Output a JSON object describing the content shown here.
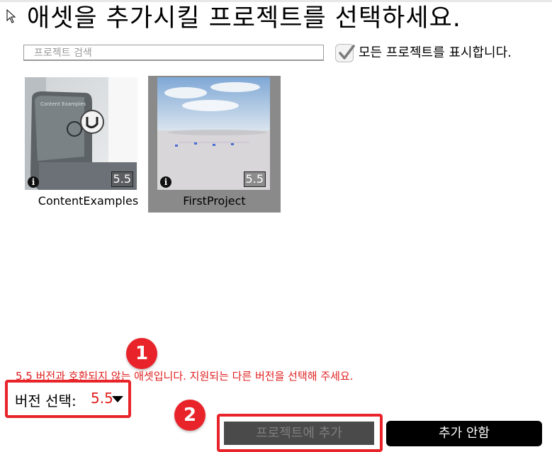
{
  "dialog": {
    "title": "애셋을 추가시킬 프로젝트를 선택하세요.",
    "search_placeholder": "프로젝트 검색",
    "show_all_label": "모든 프로젝트를 표시합니다.",
    "show_all_checked": true
  },
  "projects": [
    {
      "name": "ContentExamples",
      "version": "5.5",
      "selected": false,
      "thumb_text": "Content Examples"
    },
    {
      "name": "FirstProject",
      "version": "5.5",
      "selected": true
    }
  ],
  "footer": {
    "warning": "5.5 버전과 호환되지 않는 애셋입니다. 지원되는 다른 버전을 선택해 주세요.",
    "version_label": "버전 선택:",
    "version_value": "5.5",
    "add_button": "프로젝트에 추가",
    "cancel_button": "추가 안함"
  },
  "annotations": [
    "1",
    "2"
  ],
  "colors": {
    "accent_red": "#e8242a",
    "warning_text": "#e02020",
    "selected_tile": "#8a8a8a"
  }
}
